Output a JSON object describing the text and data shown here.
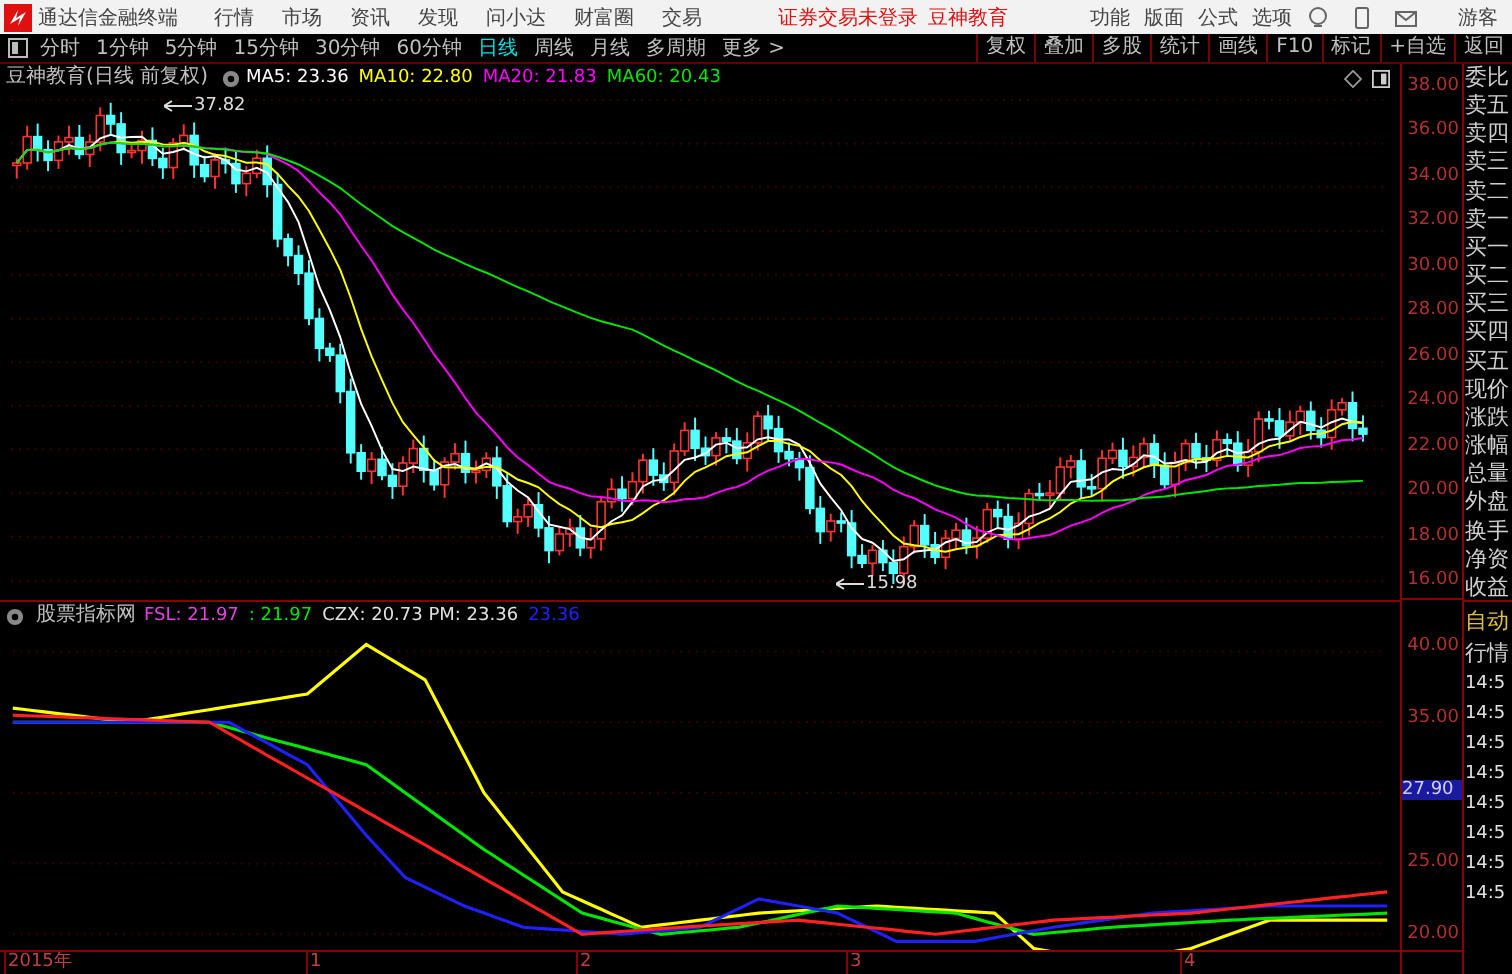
{
  "menu_bar": {
    "app_title": "通达信金融终端",
    "items": [
      "行情",
      "市场",
      "资讯",
      "发现",
      "问小达",
      "财富圈",
      "交易"
    ],
    "status": [
      {
        "text": "证券交易未登录"
      },
      {
        "text": "豆神教育"
      }
    ],
    "tools": [
      "功能",
      "版面",
      "公式",
      "选项"
    ],
    "user": "游客"
  },
  "period_tabs": [
    {
      "label": "分时",
      "selected": false
    },
    {
      "label": "1分钟",
      "selected": false
    },
    {
      "label": "5分钟",
      "selected": false
    },
    {
      "label": "15分钟",
      "selected": false
    },
    {
      "label": "30分钟",
      "selected": false
    },
    {
      "label": "60分钟",
      "selected": false
    },
    {
      "label": "日线",
      "selected": true
    },
    {
      "label": "周线",
      "selected": false
    },
    {
      "label": "月线",
      "selected": false
    },
    {
      "label": "多周期",
      "selected": false
    },
    {
      "label": "更多 >",
      "selected": false
    }
  ],
  "tool_buttons": [
    "复权",
    "叠加",
    "多股",
    "统计",
    "画线",
    "F10",
    "标记",
    "+自选",
    "返回"
  ],
  "price_pane": {
    "title": "豆神教育(日线 前复权)",
    "indicators": [
      {
        "label": "MA5: 23.36",
        "color": "#ffffff"
      },
      {
        "label": "MA10: 22.80",
        "color": "#ffff00"
      },
      {
        "label": "MA20: 21.83",
        "color": "#ff00ff"
      },
      {
        "label": "MA60: 20.43",
        "color": "#00e600"
      }
    ],
    "high_label": "37.82",
    "low_label": "15.98",
    "axis": [
      "38.00",
      "36.00",
      "34.00",
      "32.00",
      "30.00",
      "28.00",
      "26.00",
      "24.00",
      "22.00",
      "20.00",
      "18.00",
      "16.00"
    ]
  },
  "indicator_pane": {
    "title": "股票指标网",
    "values": [
      {
        "label": "FSL: 21.97",
        "color": "#e040e0"
      },
      {
        "label": ": 21.97",
        "color": "#00e600"
      },
      {
        "label": "CZX: 20.73 PM: 23.36",
        "color": "#e0e0e0"
      },
      {
        "label": "23.36",
        "color": "#2020ff"
      }
    ],
    "axis": [
      {
        "text": "40.00",
        "kind": "tick"
      },
      {
        "text": "35.00",
        "kind": "tick"
      },
      {
        "text": "27.90",
        "kind": "cursor"
      },
      {
        "text": "25.00",
        "kind": "tick"
      },
      {
        "text": "20.00",
        "kind": "tick"
      }
    ]
  },
  "time_axis": [
    "2015年",
    "1",
    "2",
    "3",
    "4"
  ],
  "quote_panel": {
    "labels": [
      "委比",
      "卖五",
      "卖四",
      "卖三",
      "卖二",
      "卖一",
      "买一",
      "买二",
      "买三",
      "买四",
      "买五",
      "现价",
      "涨跌",
      "涨幅",
      "总量",
      "外盘",
      "换手",
      "净资",
      "收益"
    ],
    "mode": "自动",
    "section": "行情",
    "times": [
      "14:5",
      "14:5",
      "14:5",
      "14:5",
      "14:5",
      "14:5",
      "14:5",
      "14:5"
    ]
  }
}
